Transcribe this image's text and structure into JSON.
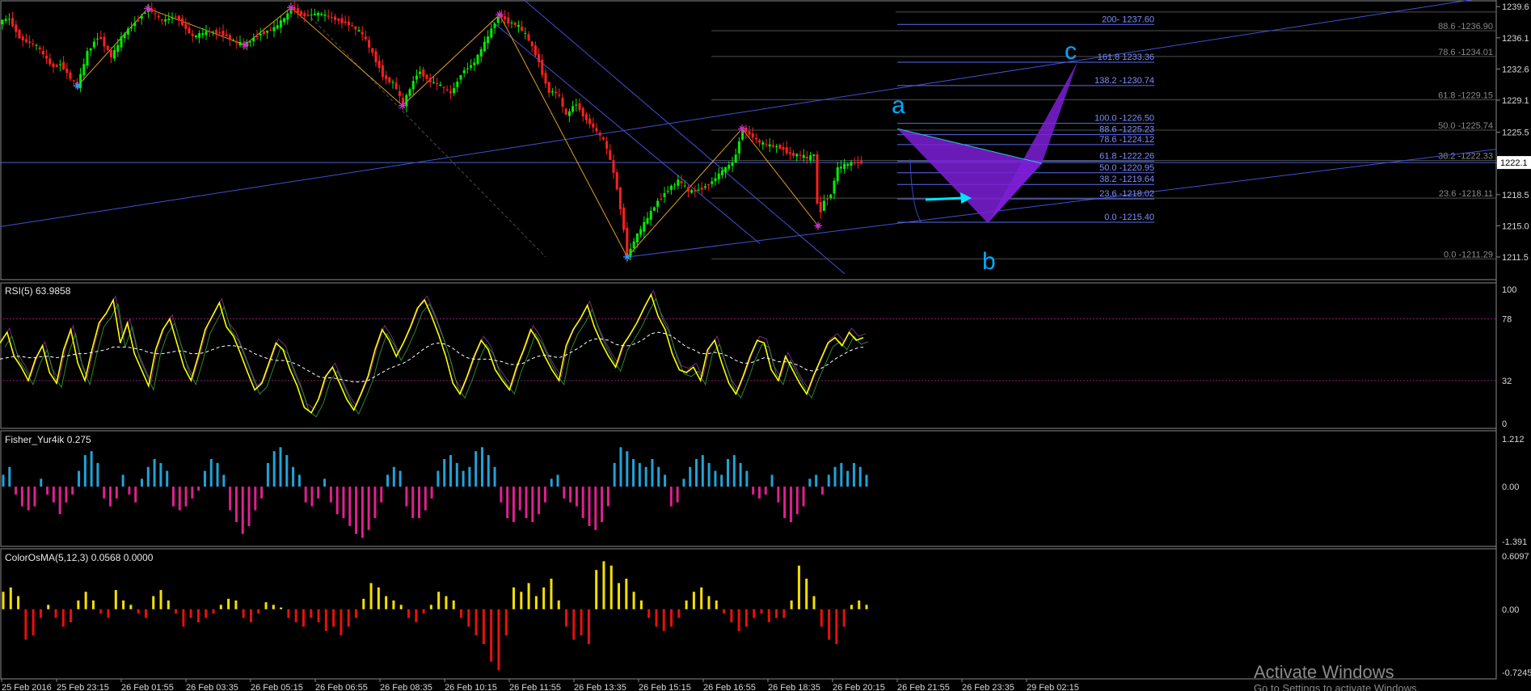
{
  "chart_data": [
    {
      "type": "candlestick",
      "title": "",
      "ylim": [
        1209.5,
        1239.8
      ],
      "y_ticks": [
        "1239.6",
        "1236.1",
        "1232.6",
        "1229.1",
        "1225.5",
        "1222.1",
        "1218.5",
        "1215.0",
        "1211.5"
      ],
      "current_price": "1222.1",
      "x_tick_labels": [
        "25 Feb 2016",
        "25 Feb 23:15",
        "26 Feb 01:55",
        "26 Feb 03:35",
        "26 Feb 05:15",
        "26 Feb 06:55",
        "26 Feb 08:35",
        "26 Feb 10:15",
        "26 Feb 11:55",
        "26 Feb 13:35",
        "26 Feb 15:15",
        "26 Feb 16:55",
        "26 Feb 18:35",
        "26 Feb 20:15",
        "26 Feb 21:55",
        "26 Feb 23:35",
        "29 Feb 02:15"
      ],
      "price_path": [
        [
          0,
          1237.8
        ],
        [
          10,
          1238.4
        ],
        [
          25,
          1236.0
        ],
        [
          45,
          1235.2
        ],
        [
          65,
          1232.8
        ],
        [
          75,
          1233.2
        ],
        [
          88,
          1231.4
        ],
        [
          96,
          1230.7
        ],
        [
          108,
          1234.5
        ],
        [
          122,
          1236.4
        ],
        [
          138,
          1233.9
        ],
        [
          152,
          1236.4
        ],
        [
          172,
          1238.3
        ],
        [
          183,
          1239.4
        ],
        [
          200,
          1238.0
        ],
        [
          218,
          1238.5
        ],
        [
          238,
          1236.2
        ],
        [
          258,
          1236.8
        ],
        [
          275,
          1236.6
        ],
        [
          290,
          1235.6
        ],
        [
          303,
          1235.3
        ],
        [
          320,
          1236.5
        ],
        [
          340,
          1237.2
        ],
        [
          355,
          1238.6
        ],
        [
          360,
          1239.5
        ],
        [
          375,
          1238.6
        ],
        [
          395,
          1238.8
        ],
        [
          415,
          1238.2
        ],
        [
          432,
          1237.6
        ],
        [
          448,
          1236.5
        ],
        [
          460,
          1234.5
        ],
        [
          475,
          1231.6
        ],
        [
          488,
          1230.9
        ],
        [
          498,
          1228.5
        ],
        [
          508,
          1230.6
        ],
        [
          518,
          1232.5
        ],
        [
          530,
          1231.3
        ],
        [
          545,
          1230.7
        ],
        [
          558,
          1229.8
        ],
        [
          572,
          1232.4
        ],
        [
          586,
          1233.2
        ],
        [
          600,
          1235.6
        ],
        [
          612,
          1237.8
        ],
        [
          618,
          1238.7
        ],
        [
          628,
          1237.9
        ],
        [
          640,
          1237.5
        ],
        [
          652,
          1236.2
        ],
        [
          665,
          1233.8
        ],
        [
          678,
          1230.1
        ],
        [
          690,
          1229.9
        ],
        [
          700,
          1227.3
        ],
        [
          712,
          1228.8
        ],
        [
          722,
          1227.3
        ],
        [
          735,
          1225.9
        ],
        [
          748,
          1224.4
        ],
        [
          760,
          1220.7
        ],
        [
          770,
          1215.7
        ],
        [
          776,
          1211.5
        ],
        [
          785,
          1213.5
        ],
        [
          798,
          1215.4
        ],
        [
          812,
          1217.6
        ],
        [
          826,
          1219.1
        ],
        [
          840,
          1220.1
        ],
        [
          852,
          1218.8
        ],
        [
          866,
          1219.1
        ],
        [
          880,
          1219.9
        ],
        [
          895,
          1221.3
        ],
        [
          908,
          1222.2
        ],
        [
          918,
          1225.9
        ],
        [
          928,
          1225.2
        ],
        [
          940,
          1224.3
        ],
        [
          952,
          1224.0
        ],
        [
          965,
          1223.8
        ],
        [
          978,
          1223.0
        ],
        [
          990,
          1222.9
        ],
        [
          1000,
          1222.5
        ],
        [
          1008,
          1223.2
        ],
        [
          1012,
          1215.5
        ],
        [
          1018,
          1217.7
        ],
        [
          1028,
          1218.5
        ],
        [
          1035,
          1221.4
        ],
        [
          1045,
          1221.8
        ],
        [
          1055,
          1222.1
        ],
        [
          1068,
          1222.1
        ]
      ],
      "pivot_markers": [
        {
          "x": 96,
          "y": 1230.7,
          "color": "#3399ff"
        },
        {
          "x": 183,
          "y": 1239.4,
          "color": "#cc33cc"
        },
        {
          "x": 303,
          "y": 1235.3,
          "color": "#cc33cc"
        },
        {
          "x": 360,
          "y": 1239.5,
          "color": "#cc33cc"
        },
        {
          "x": 498,
          "y": 1228.5,
          "color": "#cc33cc"
        },
        {
          "x": 618,
          "y": 1238.7,
          "color": "#cc33cc"
        },
        {
          "x": 776,
          "y": 1211.5,
          "color": "#3399ff"
        },
        {
          "x": 918,
          "y": 1225.9,
          "color": "#cc33cc"
        },
        {
          "x": 1012,
          "y": 1215.0,
          "color": "#cc33cc"
        }
      ],
      "fib_levels_right": [
        "88.6 -1236.90",
        "78.6 -1234.01",
        "61.8 -1229.15",
        "50.0 -1225.74",
        "38.2 -1222.33",
        "23.6 -1218.11",
        "0.0 -1211.29"
      ],
      "fib_levels_right_values": [
        1236.9,
        1234.01,
        1229.15,
        1225.74,
        1222.33,
        1218.11,
        1211.29
      ],
      "fib_levels_center": [
        "200- 1237.60",
        "161.8 1233.36",
        "138.2 -1230.74",
        "100.0 -1226.50",
        "88.6 -1225.23",
        "78.6 -1224.12",
        "61.8 -1222.26",
        "50.0 -1220.95",
        "38.2 -1219.64",
        "23.6 -1218.02",
        "0.0 -1215.40"
      ],
      "fib_levels_center_values": [
        1237.6,
        1233.36,
        1230.74,
        1226.5,
        1225.23,
        1224.12,
        1222.26,
        1220.95,
        1219.64,
        1218.02,
        1215.4
      ],
      "wave_labels": [
        "a",
        "b",
        "c"
      ],
      "colors": {
        "bull": "#00ee00",
        "bear": "#ff2020",
        "grid": "#505050",
        "fib": "#6070ff",
        "wave_label": "#00aaff",
        "pattern": "#7d1fd6",
        "arrow": "#00e5ff",
        "zigzag": "#e0a020"
      }
    },
    {
      "type": "line",
      "title": "RSI(5) 63.9858",
      "ylim": [
        0,
        100
      ],
      "y_ticks": [
        "100",
        "78",
        "32",
        "0"
      ],
      "levels": [
        78,
        32
      ],
      "series": [
        {
          "values": [
            60,
            68,
            50,
            42,
            32,
            48,
            58,
            38,
            30,
            55,
            70,
            45,
            32,
            55,
            75,
            82,
            92,
            60,
            75,
            52,
            40,
            28,
            55,
            70,
            78,
            60,
            42,
            32,
            50,
            70,
            80,
            90,
            72,
            65,
            52,
            38,
            25,
            30,
            45,
            60,
            55,
            40,
            28,
            12,
            8,
            18,
            35,
            42,
            30,
            18,
            10,
            22,
            35,
            55,
            70,
            62,
            50,
            60,
            72,
            86,
            92,
            80,
            66,
            50,
            30,
            22,
            35,
            50,
            62,
            55,
            40,
            32,
            25,
            42,
            55,
            70,
            62,
            50,
            40,
            32,
            58,
            70,
            78,
            88,
            72,
            60,
            50,
            42,
            58,
            66,
            75,
            86,
            96,
            80,
            70,
            52,
            40,
            38,
            42,
            32,
            55,
            62,
            45,
            30,
            22,
            35,
            50,
            62,
            60,
            40,
            32,
            50,
            40,
            30,
            22,
            36,
            48,
            60,
            64,
            58,
            68,
            62,
            64
          ]
        },
        {
          "values": [
            48,
            49,
            50,
            50,
            49,
            49,
            50,
            50,
            49,
            50,
            51,
            52,
            52,
            53,
            54,
            55,
            57,
            57,
            57,
            56,
            55,
            53,
            52,
            52,
            53,
            54,
            54,
            52,
            52,
            53,
            55,
            57,
            58,
            58,
            57,
            55,
            52,
            50,
            48,
            47,
            47,
            46,
            44,
            41,
            38,
            35,
            34,
            34,
            33,
            32,
            31,
            31,
            32,
            35,
            38,
            41,
            43,
            45,
            48,
            52,
            56,
            59,
            60,
            59,
            56,
            52,
            49,
            48,
            48,
            48,
            47,
            46,
            44,
            44,
            45,
            48,
            50,
            51,
            50,
            49,
            51,
            54,
            57,
            61,
            63,
            63,
            62,
            59,
            58,
            58,
            60,
            63,
            67,
            68,
            67,
            65,
            61,
            57,
            55,
            52,
            52,
            53,
            52,
            50,
            47,
            45,
            45,
            47,
            49,
            48,
            46,
            46,
            45,
            43,
            40,
            39,
            41,
            44,
            48,
            51,
            54,
            56,
            57
          ]
        }
      ]
    },
    {
      "type": "bar",
      "title": "Fisher_Yur4ik 0.275",
      "ylim": [
        -1.391,
        1.212
      ],
      "y_ticks": [
        "1.212",
        "0.00",
        "-1.391"
      ],
      "colors": {
        "positive": "#1fa3d8",
        "negative": "#e0208f"
      },
      "values": [
        0.3,
        0.5,
        -0.2,
        -0.5,
        -0.6,
        -0.5,
        0.2,
        -0.2,
        -0.4,
        -0.7,
        -0.4,
        -0.2,
        0.4,
        0.8,
        0.9,
        0.6,
        -0.3,
        -0.5,
        -0.3,
        0.3,
        -0.2,
        -0.4,
        0.2,
        0.5,
        0.7,
        0.6,
        0.4,
        -0.5,
        -0.6,
        -0.5,
        -0.3,
        -0.1,
        0.4,
        0.7,
        0.6,
        0.3,
        -0.6,
        -0.9,
        -1.2,
        -1.0,
        -0.6,
        -0.3,
        0.6,
        0.9,
        1.0,
        0.8,
        0.5,
        0.3,
        -0.4,
        -0.5,
        -0.3,
        0.2,
        -0.4,
        -0.7,
        -0.8,
        -1.0,
        -1.2,
        -1.3,
        -1.1,
        -0.8,
        -0.4,
        0.3,
        0.5,
        0.4,
        -0.5,
        -0.8,
        -0.8,
        -0.6,
        -0.3,
        0.4,
        0.7,
        0.8,
        0.6,
        0.4,
        0.5,
        0.9,
        1.0,
        0.8,
        0.5,
        -0.4,
        -0.8,
        -0.9,
        -0.6,
        -0.8,
        -0.9,
        -0.7,
        -0.4,
        0.2,
        0.3,
        -0.3,
        -0.4,
        -0.5,
        -0.8,
        -1.0,
        -1.1,
        -0.9,
        -0.5,
        0.6,
        1.0,
        0.9,
        0.7,
        0.6,
        0.5,
        0.7,
        0.5,
        0.3,
        -0.5,
        -0.4,
        0.2,
        0.5,
        0.7,
        0.8,
        0.6,
        0.4,
        0.3,
        0.7,
        0.8,
        0.6,
        0.4,
        -0.2,
        -0.3,
        -0.2,
        0.3,
        -0.4,
        -0.8,
        -0.9,
        -0.7,
        -0.5,
        0.2,
        0.3,
        -0.2,
        0.3,
        0.5,
        0.6,
        0.4,
        0.6,
        0.5,
        0.3
      ]
    },
    {
      "type": "bar",
      "title": "ColorOsMA(5,12,3) 0.0568 0.0000",
      "ylim": [
        -0.7245,
        0.6097
      ],
      "y_ticks": [
        "0.6097",
        "0.00",
        "-0.7245"
      ],
      "colors": {
        "positive": "#f5e000",
        "negative": "#e8100c"
      },
      "values": [
        0.2,
        0.25,
        0.15,
        -0.35,
        -0.3,
        -0.1,
        0.05,
        -0.1,
        -0.2,
        -0.15,
        0.1,
        0.2,
        0.1,
        -0.05,
        -0.1,
        0.22,
        0.1,
        0.05,
        -0.05,
        -0.1,
        0.15,
        0.22,
        0.1,
        -0.05,
        -0.2,
        -0.1,
        -0.15,
        -0.1,
        -0.05,
        0.05,
        0.12,
        0.1,
        -0.1,
        -0.15,
        -0.05,
        0.08,
        0.05,
        0.02,
        -0.1,
        -0.15,
        -0.2,
        -0.1,
        -0.15,
        -0.25,
        -0.2,
        -0.3,
        -0.2,
        -0.1,
        0.12,
        0.3,
        0.25,
        0.15,
        0.1,
        0.05,
        -0.1,
        -0.15,
        -0.05,
        0.05,
        0.2,
        0.15,
        0.1,
        -0.1,
        -0.2,
        -0.3,
        -0.4,
        -0.6,
        -0.7,
        -0.3,
        0.25,
        0.2,
        0.3,
        0.15,
        0.25,
        0.35,
        0.1,
        -0.2,
        -0.35,
        -0.3,
        -0.4,
        0.45,
        0.55,
        0.5,
        0.3,
        0.35,
        0.2,
        0.1,
        -0.1,
        -0.2,
        -0.25,
        -0.2,
        -0.1,
        0.1,
        0.2,
        0.25,
        0.15,
        0.1,
        -0.05,
        -0.15,
        -0.25,
        -0.2,
        -0.1,
        -0.05,
        -0.15,
        -0.1,
        -0.1,
        0.1,
        0.5,
        0.35,
        0.15,
        -0.2,
        -0.35,
        -0.4,
        -0.2,
        0.05,
        0.1,
        0.05
      ]
    }
  ],
  "watermark": "Activate Windows",
  "watermark_sub": "Go to Settings to activate Windows."
}
